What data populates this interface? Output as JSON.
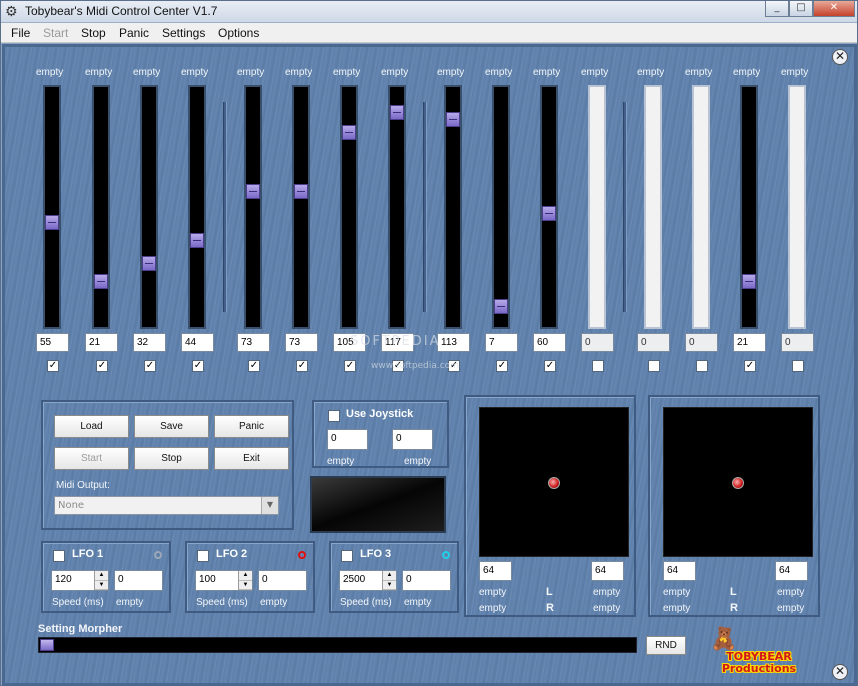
{
  "window": {
    "title": "Tobybear's Midi Control Center V1.7"
  },
  "menu": {
    "file": "File",
    "start": "Start",
    "stop": "Stop",
    "panic": "Panic",
    "settings": "Settings",
    "options": "Options"
  },
  "sliders": [
    {
      "label": "empty",
      "value": "55",
      "level": 0.43,
      "checked": true,
      "enabled": true
    },
    {
      "label": "empty",
      "value": "21",
      "level": 0.17,
      "checked": true,
      "enabled": true
    },
    {
      "label": "empty",
      "value": "32",
      "level": 0.25,
      "checked": true,
      "enabled": true
    },
    {
      "label": "empty",
      "value": "44",
      "level": 0.35,
      "checked": true,
      "enabled": true
    },
    {
      "label": "empty",
      "value": "73",
      "level": 0.57,
      "checked": true,
      "enabled": true
    },
    {
      "label": "empty",
      "value": "73",
      "level": 0.57,
      "checked": true,
      "enabled": true
    },
    {
      "label": "empty",
      "value": "105",
      "level": 0.83,
      "checked": true,
      "enabled": true
    },
    {
      "label": "empty",
      "value": "117",
      "level": 0.92,
      "checked": true,
      "enabled": true
    },
    {
      "label": "empty",
      "value": "113",
      "level": 0.89,
      "checked": true,
      "enabled": true
    },
    {
      "label": "empty",
      "value": "7",
      "level": 0.06,
      "checked": true,
      "enabled": true
    },
    {
      "label": "empty",
      "value": "60",
      "level": 0.47,
      "checked": true,
      "enabled": true
    },
    {
      "label": "empty",
      "value": "0",
      "level": 0,
      "checked": false,
      "enabled": false
    },
    {
      "label": "empty",
      "value": "0",
      "level": 0,
      "checked": false,
      "enabled": false
    },
    {
      "label": "empty",
      "value": "0",
      "level": 0,
      "checked": false,
      "enabled": false
    },
    {
      "label": "empty",
      "value": "21",
      "level": 0.17,
      "checked": true,
      "enabled": true
    },
    {
      "label": "empty",
      "value": "0",
      "level": 0,
      "checked": false,
      "enabled": false
    }
  ],
  "controls": {
    "load": "Load",
    "save": "Save",
    "panic": "Panic",
    "start": "Start",
    "stop": "Stop",
    "exit": "Exit",
    "midi_output_label": "Midi Output:",
    "midi_output_value": "None"
  },
  "joystick": {
    "label": "Use Joystick",
    "x_value": "0",
    "y_value": "0",
    "x_label": "empty",
    "y_label": "empty"
  },
  "lfos": [
    {
      "label": "LFO 1",
      "speed": "120",
      "value": "0",
      "speed_label": "Speed (ms)",
      "target_label": "empty",
      "led_color": "#9aa8b8"
    },
    {
      "label": "LFO 2",
      "speed": "100",
      "value": "0",
      "speed_label": "Speed (ms)",
      "target_label": "empty",
      "led_color": "#e01010"
    },
    {
      "label": "LFO 3",
      "speed": "2500",
      "value": "0",
      "speed_label": "Speed (ms)",
      "target_label": "empty",
      "led_color": "#20d0e8"
    }
  ],
  "xy_pads": [
    {
      "x_value": "64",
      "y_value": "64",
      "left_label_top": "empty",
      "left_label_bottom": "empty",
      "l": "L",
      "r": "R",
      "right_label_top": "empty",
      "right_label_bottom": "empty"
    },
    {
      "x_value": "64",
      "y_value": "64",
      "left_label_top": "empty",
      "left_label_bottom": "empty",
      "l": "L",
      "r": "R",
      "right_label_top": "empty",
      "right_label_bottom": "empty"
    }
  ],
  "morpher": {
    "label": "Setting Morpher",
    "rnd": "RND"
  },
  "logo": {
    "line1": "TOBYBEAR",
    "line2": "Productions"
  },
  "watermark": {
    "line1": "SOFTPEDIA",
    "line2": "www.softpedia.com"
  }
}
